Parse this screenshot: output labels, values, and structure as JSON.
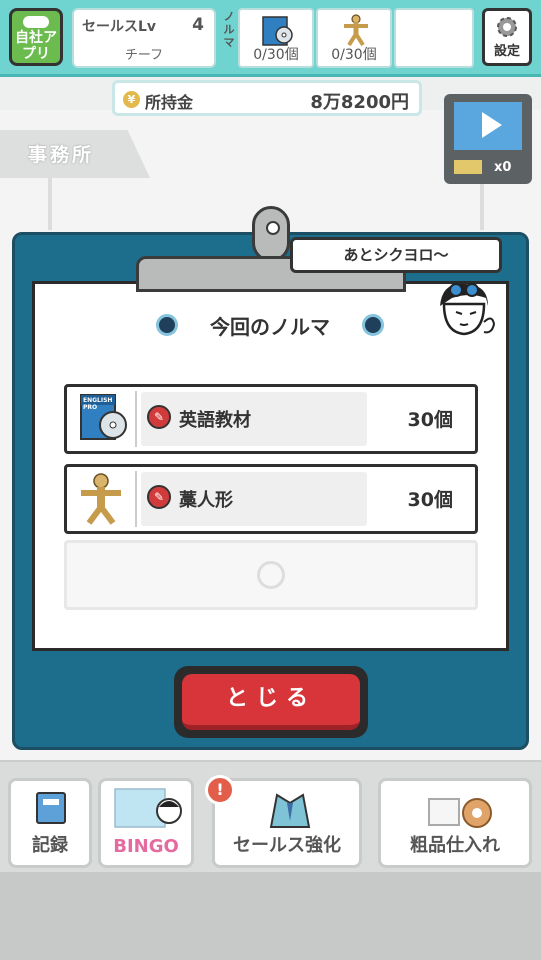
{
  "hud": {
    "app_label": "自社アプリ",
    "sales_label": "セールスLv",
    "sales_level": "4",
    "sales_rank": "チーフ",
    "norma_label": "ノルマ",
    "quota_slots": [
      {
        "icon": "english-textbook-icon",
        "count": "0/30個"
      },
      {
        "icon": "straw-doll-icon",
        "count": "0/30個"
      },
      {
        "icon": "empty-slot",
        "count": ""
      }
    ],
    "settings_label": "設定"
  },
  "money": {
    "label": "所持金",
    "value": "8万8200円",
    "coin_symbol": "¥"
  },
  "video": {
    "ticket_count": "x0"
  },
  "office_label": "事務所",
  "modal": {
    "speech": "あとシクヨロ〜",
    "title": "今回のノルマ",
    "items": [
      {
        "name": "英語教材",
        "qty": "30個",
        "thumb_text": "ENGLISH PRO"
      },
      {
        "name": "藁人形",
        "qty": "30個"
      }
    ],
    "close_label": "とじる"
  },
  "bottom_menu": [
    {
      "label": "記録"
    },
    {
      "label": "BINGO"
    },
    {
      "label": "セールス強化",
      "badge": "!"
    },
    {
      "label": "粗品仕入れ"
    }
  ],
  "colors": {
    "hud": "#6fd3d0",
    "modal": "#1d6e8d",
    "close": "#d8353a",
    "accent_green": "#6bbb4f"
  }
}
